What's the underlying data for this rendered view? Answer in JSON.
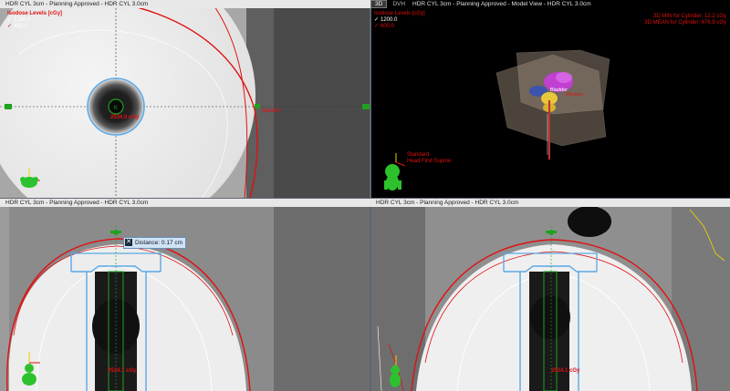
{
  "panes": {
    "transverse": {
      "title": "HDR CYL 3cm  -  Planning Approved  -  HDR CYL 3.0cm",
      "legend_title": "Isodose Levels [cGy]",
      "levels": [
        {
          "value": "1200.0"
        },
        {
          "value": "600.0"
        }
      ],
      "point_dose": "2534.0 cGy",
      "structure_label": "Bladder"
    },
    "model": {
      "tab_3d": "3D",
      "tab_dvh": "DVH",
      "title": "HDR CYL 3cm  -  Planning Approved  -  Model View  -  HDR CYL 3.0cm",
      "legend_title": "Isodose Levels [cGy]",
      "levels": [
        {
          "value": "1200.0"
        },
        {
          "value": "600.0"
        }
      ],
      "stat_min": "3D MIN for Cylinder: 12.2 cGy",
      "stat_mean": "3D MEAN for Cylinder: 676.9 cGy",
      "orient_line1": "Standard",
      "orient_line2": "Head First-Supine",
      "struct_bladder": "Bladder",
      "struct_rectum": "Rectum"
    },
    "sagittal": {
      "title": "HDR CYL 3cm  -  Planning Approved  -  HDR CYL 3.0cm",
      "distance": "Distance: 0.17 cm",
      "point_dose": "2534.7 cGy"
    },
    "coronal": {
      "title": "HDR CYL 3cm  -  Planning Approved  -  HDR CYL 3.0cm",
      "point_dose": "2534.1 cGy"
    }
  },
  "colors": {
    "isodose_high": "#e01010",
    "isodose_low": "#ffffff",
    "cylinder": "#5aa8e6",
    "applicator": "#1fa21f",
    "marker": "#f2d000"
  }
}
